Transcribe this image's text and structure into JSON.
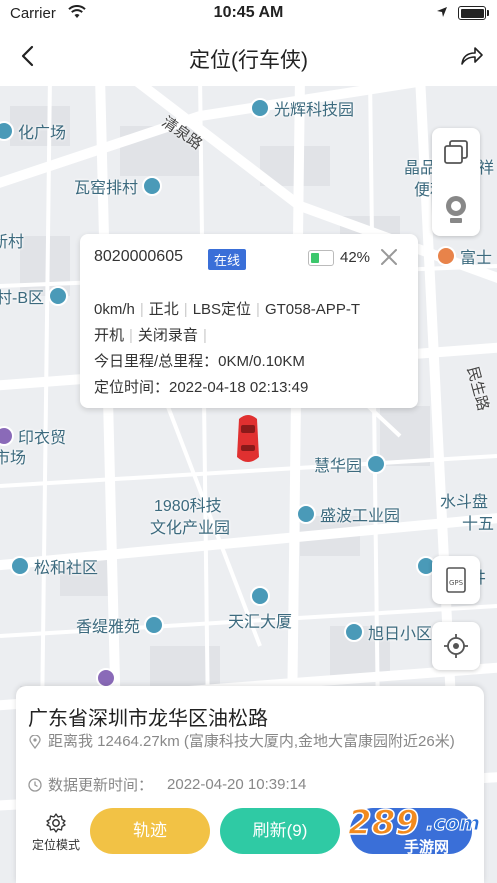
{
  "status_bar": {
    "carrier": "Carrier",
    "time": "10:45 AM"
  },
  "nav": {
    "title": "定位(行车侠)"
  },
  "map": {
    "pois": [
      "光辉科技园",
      "化广场",
      "清泉路",
      "晶品",
      "便利超市",
      "瓦窑排村",
      "新村",
      "富士",
      "村-B区",
      "民生路",
      "印衣贸",
      "市场",
      "慧华园",
      "1980科技",
      "文化产业园",
      "盛波工业园",
      "水斗盘",
      "十五",
      "松和社区",
      "工",
      "香缇雅苑",
      "天汇大厦",
      "旭日小区",
      "祥",
      "井"
    ]
  },
  "popup": {
    "device_id": "8020000605",
    "status": "在线",
    "battery_percent": "42%",
    "battery_level": 0.42,
    "speed": "0km/h",
    "direction": "正北",
    "loc_type": "LBS定位",
    "model": "GT058-APP-T",
    "power": "开机",
    "recording": "关闭录音",
    "mileage": "今日里程/总里程：0KM/0.10KM",
    "loc_time": "定位时间：2022-04-18 02:13:49"
  },
  "panel": {
    "address": "广东省深圳市龙华区油松路",
    "distance": "距离我 12464.27km (富康科技大厦内,金地大富康园附近26米)",
    "update_label": "数据更新时间：",
    "update_time": "2022-04-20 10:39:14",
    "mode_label": "定位模式",
    "track_label": "轨迹",
    "refresh_label": "刷新(9)"
  },
  "watermark": {
    "text": "289",
    "sub": "手游网"
  },
  "colors": {
    "online": "#3a6fd8",
    "track": "#f2c245",
    "refresh": "#2fcaa4",
    "battery": "#3cc76c",
    "car": "#e03030"
  }
}
